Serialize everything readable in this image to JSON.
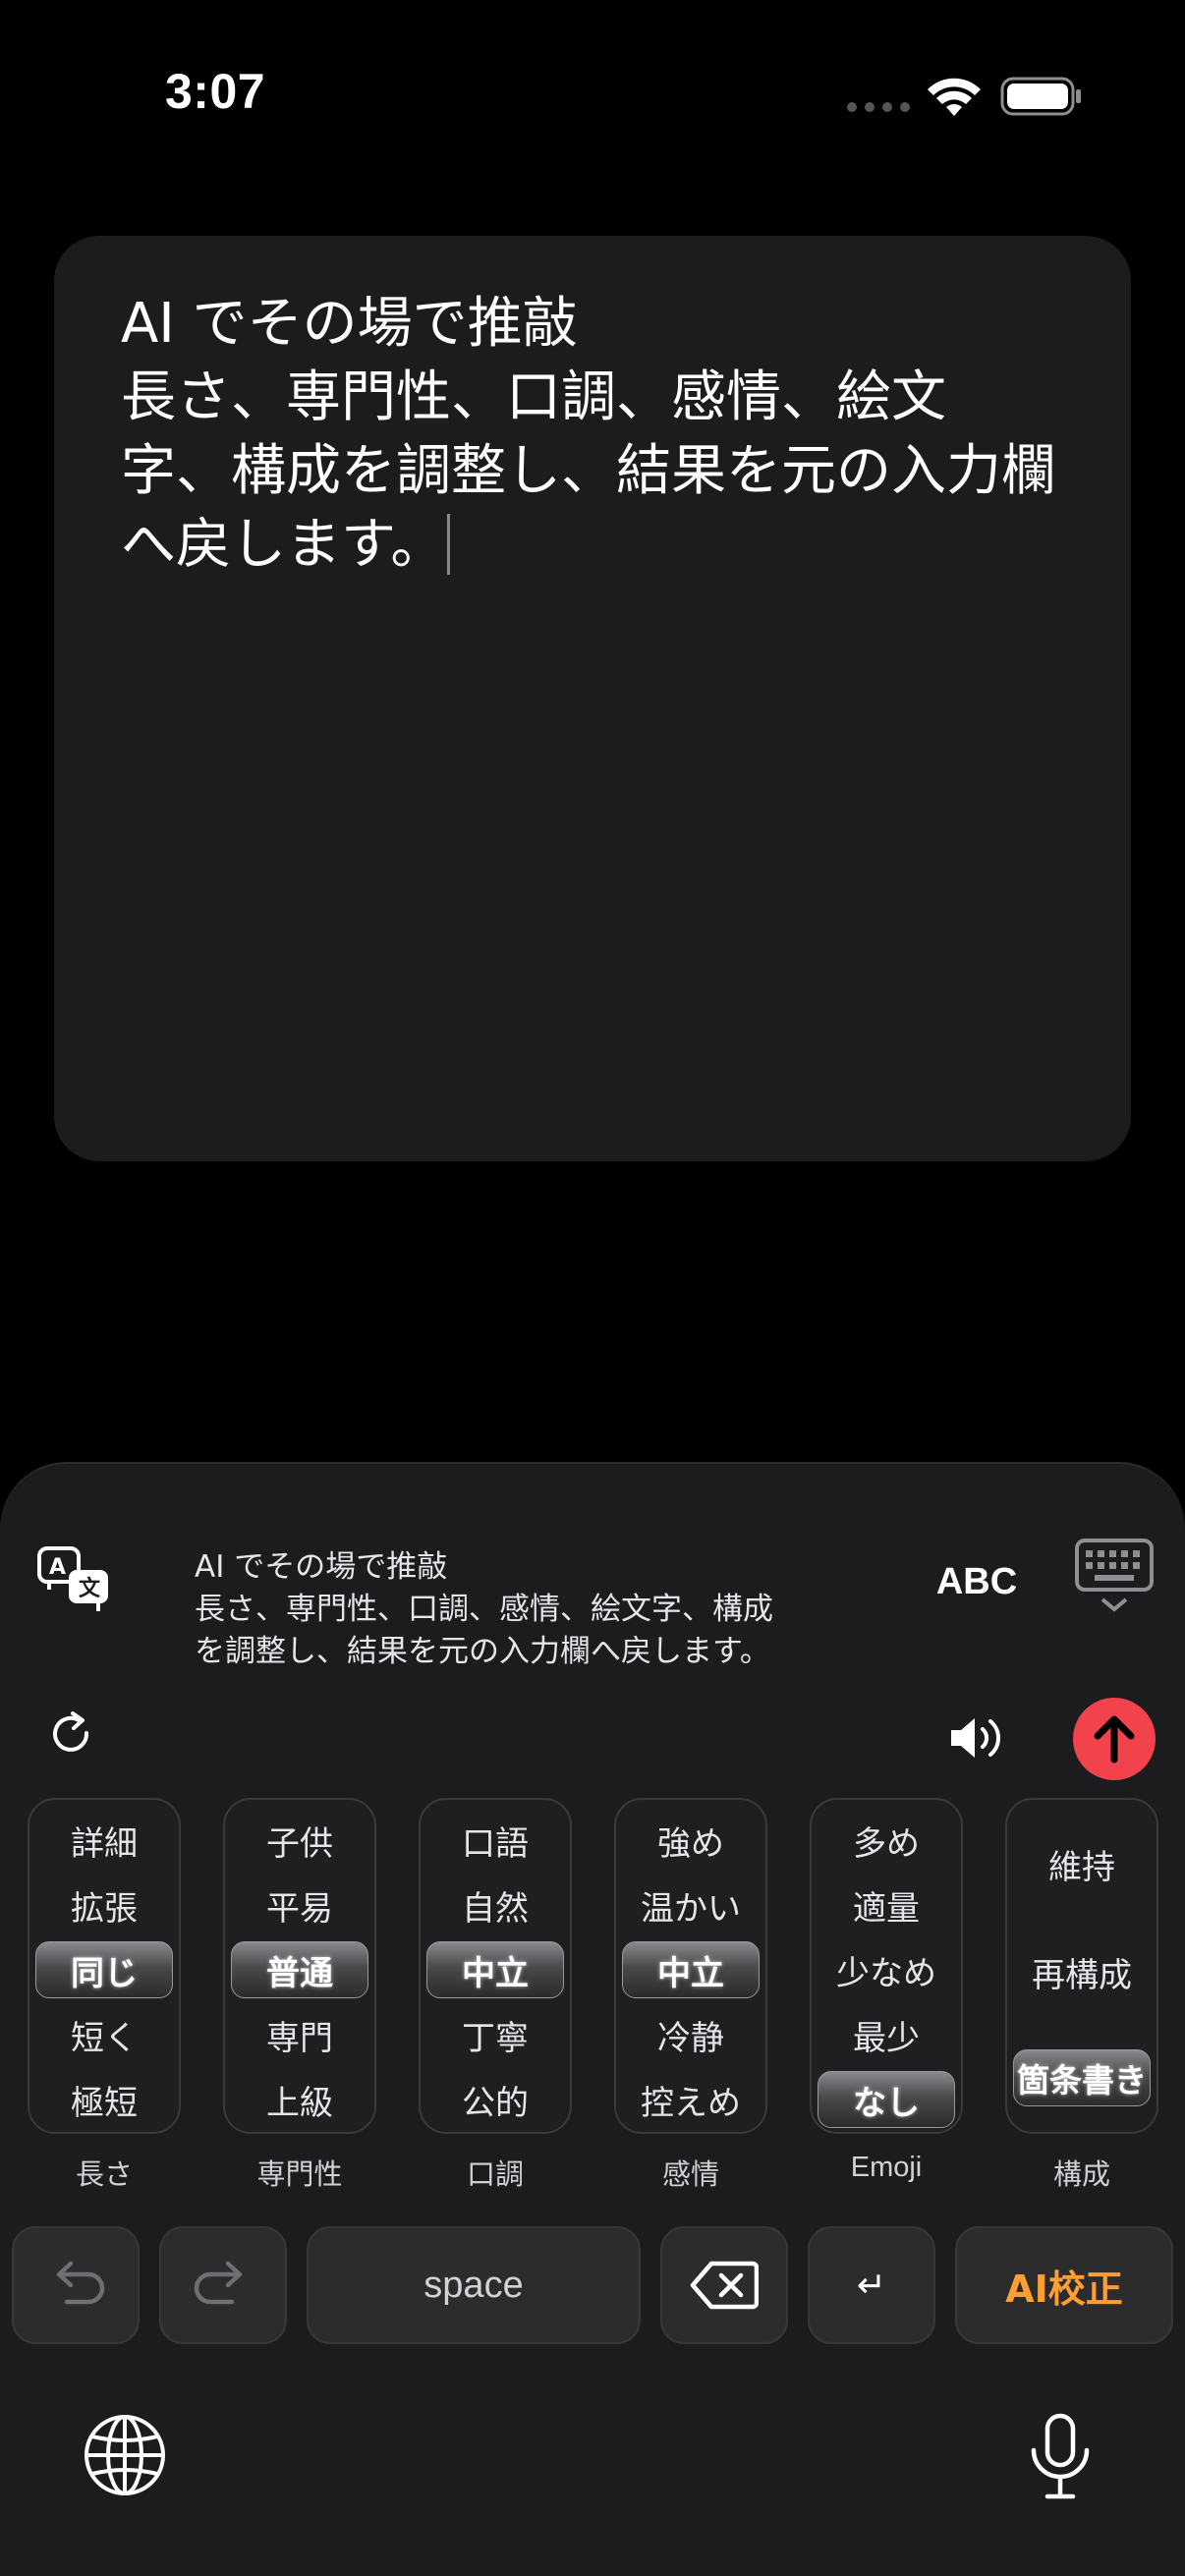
{
  "status_bar": {
    "time": "3:07"
  },
  "editor": {
    "text": "AI でその場で推敲\n長さ、専門性、口調、感情、絵文\n字、構成を調整し、結果を元の入力欄\nへ戻します。"
  },
  "keyboard": {
    "preview_text": "AI でその場で推敲\n長さ、専門性、口調、感情、絵文字、構成\nを調整し、結果を元の入力欄へ戻します。",
    "abc_label": "ABC",
    "accent_color": "#f2424b",
    "pickers": [
      {
        "label": "長さ",
        "items": [
          "詳細",
          "拡張",
          "同じ",
          "短く",
          "極短"
        ],
        "selected": "同じ"
      },
      {
        "label": "専門性",
        "items": [
          "子供",
          "平易",
          "普通",
          "専門",
          "上級"
        ],
        "selected": "普通"
      },
      {
        "label": "口調",
        "items": [
          "口語",
          "自然",
          "中立",
          "丁寧",
          "公的"
        ],
        "selected": "中立"
      },
      {
        "label": "感情",
        "items": [
          "強め",
          "温かい",
          "中立",
          "冷静",
          "控えめ"
        ],
        "selected": "中立"
      },
      {
        "label": "Emoji",
        "items": [
          "多め",
          "適量",
          "少なめ",
          "最少",
          "なし"
        ],
        "selected": "なし"
      },
      {
        "label": "構成",
        "items": [
          "維持",
          "再構成",
          "箇条書き"
        ],
        "selected": "箇条書き"
      }
    ],
    "keys": {
      "space_label": "space",
      "return_glyph": "↵",
      "ai_label": "AI校正"
    },
    "icons": [
      "translate-icon",
      "keyboard-switch-icon",
      "refresh-icon",
      "speaker-icon",
      "send-arrow-icon",
      "undo-icon",
      "redo-icon",
      "delete-icon",
      "globe-icon",
      "mic-icon"
    ]
  }
}
